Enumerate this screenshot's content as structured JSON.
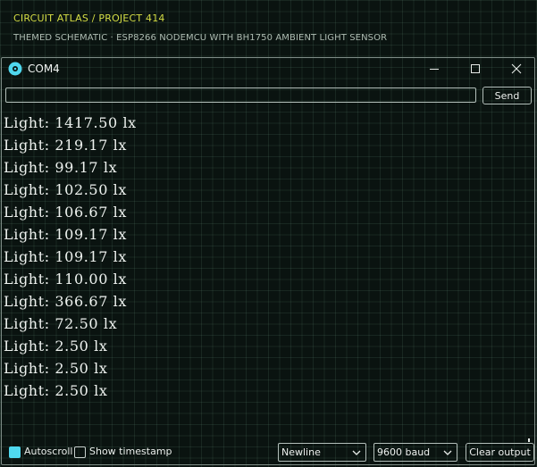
{
  "header": {
    "breadcrumb": "CIRCUIT ATLAS / PROJECT 414",
    "subtitle": "THEMED SCHEMATIC · ESP8266 NODEMCU WITH BH1750 AMBIENT LIGHT SENSOR"
  },
  "window": {
    "title": "COM4",
    "icon": "serial-monitor-icon",
    "controls": [
      "minimize-icon",
      "maximize-icon",
      "close-icon"
    ]
  },
  "input": {
    "value": "",
    "send_label": "Send"
  },
  "output": {
    "lines": [
      "Light: 1417.50 lx",
      "Light: 219.17 lx",
      "Light: 99.17 lx",
      "Light: 102.50 lx",
      "Light: 106.67 lx",
      "Light: 109.17 lx",
      "Light: 109.17 lx",
      "Light: 110.00 lx",
      "Light: 366.67 lx",
      "Light: 72.50 lx",
      "Light: 2.50 lx",
      "Light: 2.50 lx",
      "Light: 2.50 lx"
    ]
  },
  "bottom": {
    "autoscroll": {
      "label": "Autoscroll",
      "checked": true
    },
    "timestamp": {
      "label": "Show timestamp",
      "checked": false
    },
    "line_ending": "Newline",
    "baud": "9600 baud",
    "clear_label": "Clear output"
  },
  "colors": {
    "accent_yellow": "#d4dd45",
    "accent_cyan": "#4fd8ee",
    "background": "#0a1310",
    "text": "#eef2ef"
  }
}
